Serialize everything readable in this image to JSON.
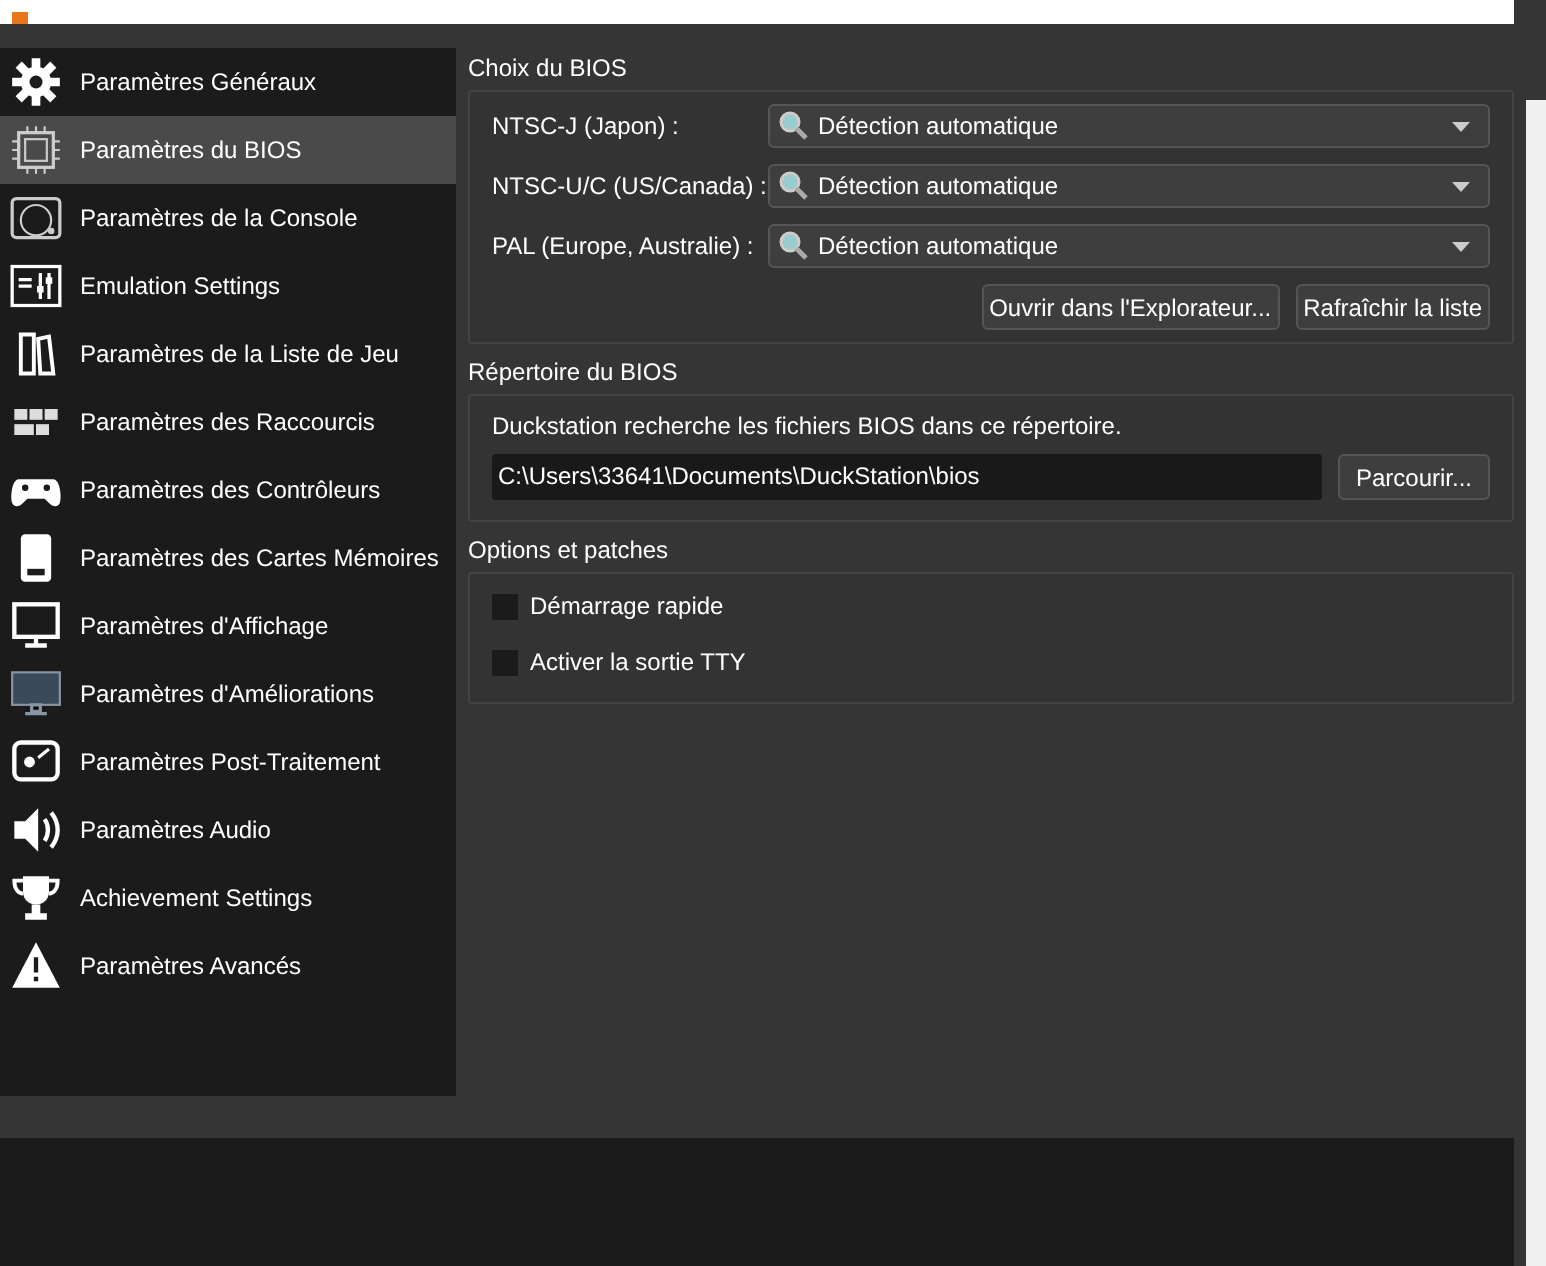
{
  "sidebar": {
    "items": [
      {
        "label": "Paramètres Généraux",
        "selected": false
      },
      {
        "label": "Paramètres du BIOS",
        "selected": true
      },
      {
        "label": "Paramètres de la Console",
        "selected": false
      },
      {
        "label": "Emulation Settings",
        "selected": false
      },
      {
        "label": "Paramètres de la Liste de Jeu",
        "selected": false
      },
      {
        "label": "Paramètres des Raccourcis",
        "selected": false
      },
      {
        "label": "Paramètres des Contrôleurs",
        "selected": false
      },
      {
        "label": "Paramètres des Cartes Mémoires",
        "selected": false
      },
      {
        "label": "Paramètres d'Affichage",
        "selected": false
      },
      {
        "label": "Paramètres d'Améliorations",
        "selected": false
      },
      {
        "label": "Paramètres Post-Traitement",
        "selected": false
      },
      {
        "label": "Paramètres Audio",
        "selected": false
      },
      {
        "label": "Achievement Settings",
        "selected": false
      },
      {
        "label": "Paramètres Avancés",
        "selected": false
      }
    ]
  },
  "bios_selection": {
    "title": "Choix du BIOS",
    "regions": [
      {
        "label": "NTSC-J (Japon) :",
        "value": "Détection automatique"
      },
      {
        "label": "NTSC-U/C (US/Canada) :",
        "value": "Détection automatique"
      },
      {
        "label": "PAL (Europe, Australie) :",
        "value": "Détection automatique"
      }
    ],
    "buttons": [
      "Ouvrir dans l'Explorateur...",
      "Rafraîchir la liste"
    ]
  },
  "bios_directory": {
    "title": "Répertoire du BIOS",
    "description": "Duckstation recherche les fichiers BIOS dans ce répertoire.",
    "path": "C:\\Users\\33641\\Documents\\DuckStation\\bios",
    "browse_button": "Parcourir..."
  },
  "options": {
    "title": "Options et patches",
    "checkboxes": [
      {
        "label": "Démarrage rapide",
        "checked": false
      },
      {
        "label": "Activer la sortie TTY",
        "checked": false
      }
    ]
  }
}
